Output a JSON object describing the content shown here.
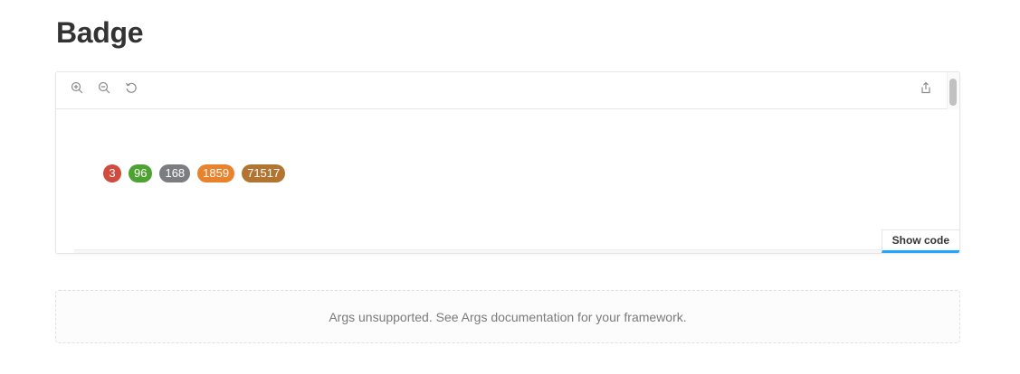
{
  "page": {
    "title": "Badge"
  },
  "toolbar": {
    "zoom_in_icon": "zoom-in",
    "zoom_out_icon": "zoom-out",
    "reset_icon": "reset-zoom",
    "share_icon": "share"
  },
  "badges": [
    {
      "value": "3",
      "color": "#d04a3d"
    },
    {
      "value": "96",
      "color": "#4ea232"
    },
    {
      "value": "168",
      "color": "#7b7d80"
    },
    {
      "value": "1859",
      "color": "#e9822c"
    },
    {
      "value": "71517",
      "color": "#b47431"
    }
  ],
  "actions": {
    "show_code": "Show code"
  },
  "args": {
    "message": "Args unsupported. See Args documentation for your framework."
  },
  "colors": {
    "accent": "#1ea7fd"
  }
}
